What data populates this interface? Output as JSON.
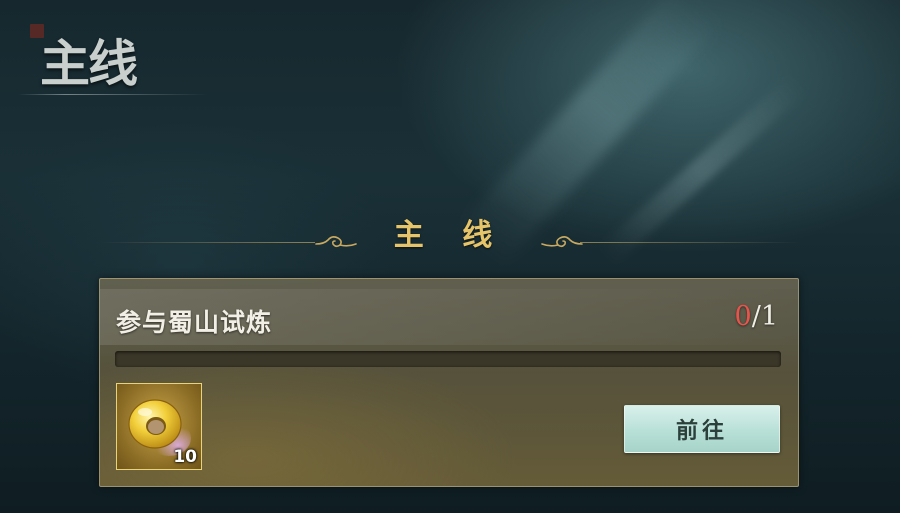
{
  "header": {
    "title": "主线"
  },
  "section": {
    "title": "主 线"
  },
  "quest": {
    "name": "参与蜀山试炼",
    "progress_current": "0",
    "progress_separator": "/",
    "progress_total": "1",
    "progress_fraction": 0
  },
  "reward": {
    "icon": "jade-ring-icon",
    "count": "10"
  },
  "go_button": {
    "label": "前往"
  },
  "colors": {
    "section_title": "#e6c46a",
    "progress_current": "#e8544c",
    "button_bg": "#b8e0d7",
    "reward_border": "#e9d37a"
  }
}
